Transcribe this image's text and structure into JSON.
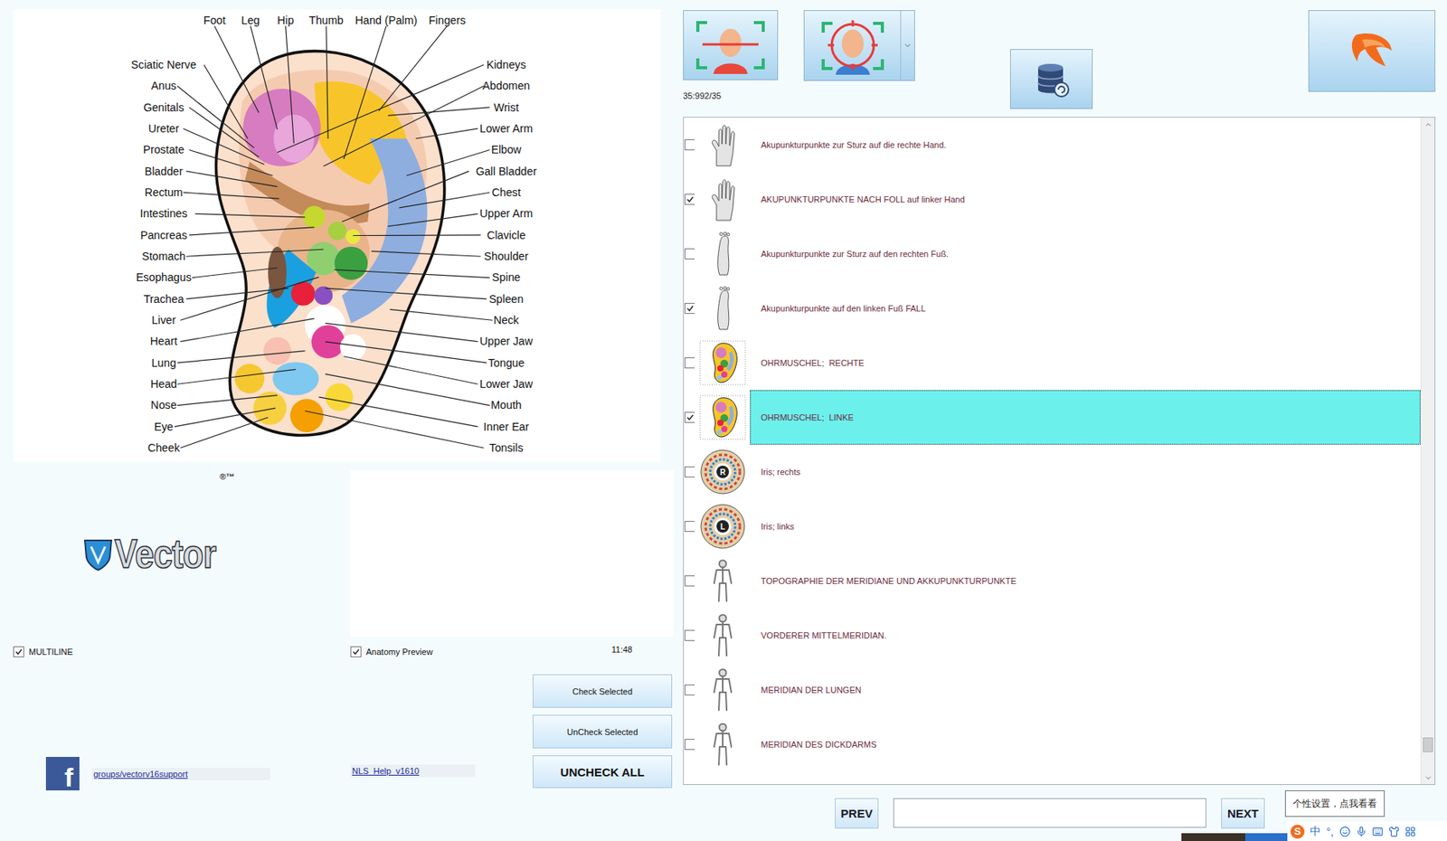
{
  "diagram": {
    "top_labels": [
      "Foot",
      "Leg",
      "Hip",
      "Thumb",
      "Hand (Palm)",
      "Fingers"
    ],
    "left_labels": [
      "Sciatic Nerve",
      "Anus",
      "Genitals",
      "Ureter",
      "Prostate",
      "Bladder",
      "Rectum",
      "Intestines",
      "Pancreas",
      "Stomach",
      "Esophagus",
      "Trachea",
      "Liver",
      "Heart",
      "Lung",
      "Head",
      "Nose",
      "Eye",
      "Cheek"
    ],
    "right_labels": [
      "Kidneys",
      "Abdomen",
      "Wrist",
      "Lower Arm",
      "Elbow",
      "Gall Bladder",
      "Chest",
      "Upper Arm",
      "Clavicle",
      "Shoulder",
      "Spine",
      "Spleen",
      "Neck",
      "Upper Jaw",
      "Tongue",
      "Lower Jaw",
      "Mouth",
      "Inner Ear",
      "Tonsils"
    ]
  },
  "logo": {
    "text": "Vector",
    "marks": "®™"
  },
  "options": [
    {
      "label": "MULTILINE",
      "checked": true
    },
    {
      "label": "Anatomy Preview",
      "checked": true
    }
  ],
  "time": "11:48",
  "actions": [
    {
      "label": "Check Selected",
      "kind": "normal"
    },
    {
      "label": "UnCheck Selected",
      "kind": "normal"
    },
    {
      "label": "UNCHECK ALL",
      "kind": "strong"
    }
  ],
  "facebook": {
    "glyph": "f",
    "link": "groups/vectorv16support"
  },
  "help_link": "NLS_Help_v1610",
  "toolbar": {
    "counter": "35:992/35"
  },
  "list": {
    "scroll": 0.97,
    "rows": [
      {
        "label": "Akupunkturpunkte zur Sturz auf die rechte Hand.",
        "checked": false,
        "selected": false,
        "kind": "hand"
      },
      {
        "label": "AKUPUNKTURPUNKTE NACH FOLL auf linker Hand",
        "checked": true,
        "selected": false,
        "kind": "hand"
      },
      {
        "label": "Akupunkturpunkte zur Sturz auf den rechten Fuß.",
        "checked": false,
        "selected": false,
        "kind": "foot"
      },
      {
        "label": "Akupunkturpunkte auf den linken Fuß FALL",
        "checked": true,
        "selected": false,
        "kind": "foot"
      },
      {
        "label": "OHRMUSCHEL;  RECHTE",
        "checked": false,
        "selected": false,
        "kind": "ear"
      },
      {
        "label": "OHRMUSCHEL;  LINKE",
        "checked": true,
        "selected": true,
        "kind": "ear"
      },
      {
        "label": "Iris; rechts",
        "checked": false,
        "selected": false,
        "kind": "iris",
        "badge": "R"
      },
      {
        "label": "Iris; links",
        "checked": false,
        "selected": false,
        "kind": "iris",
        "badge": "L"
      },
      {
        "label": "TOPOGRAPHIE DER MERIDIANE UND AKKUPUNKTURPUNKTE",
        "checked": false,
        "selected": false,
        "kind": "body"
      },
      {
        "label": "VORDERER MITTELMERIDIAN.",
        "checked": false,
        "selected": false,
        "kind": "body"
      },
      {
        "label": "MERIDIAN DER LUNGEN",
        "checked": false,
        "selected": false,
        "kind": "body"
      },
      {
        "label": "MERIDIAN DES DICKDARMS",
        "checked": false,
        "selected": false,
        "kind": "body"
      }
    ]
  },
  "pager": {
    "prev": "PREV",
    "next": "NEXT",
    "query": ""
  },
  "tooltip": "个性设置，点我看看",
  "ime": {
    "logo": "S",
    "items": [
      "中",
      "°,"
    ]
  }
}
